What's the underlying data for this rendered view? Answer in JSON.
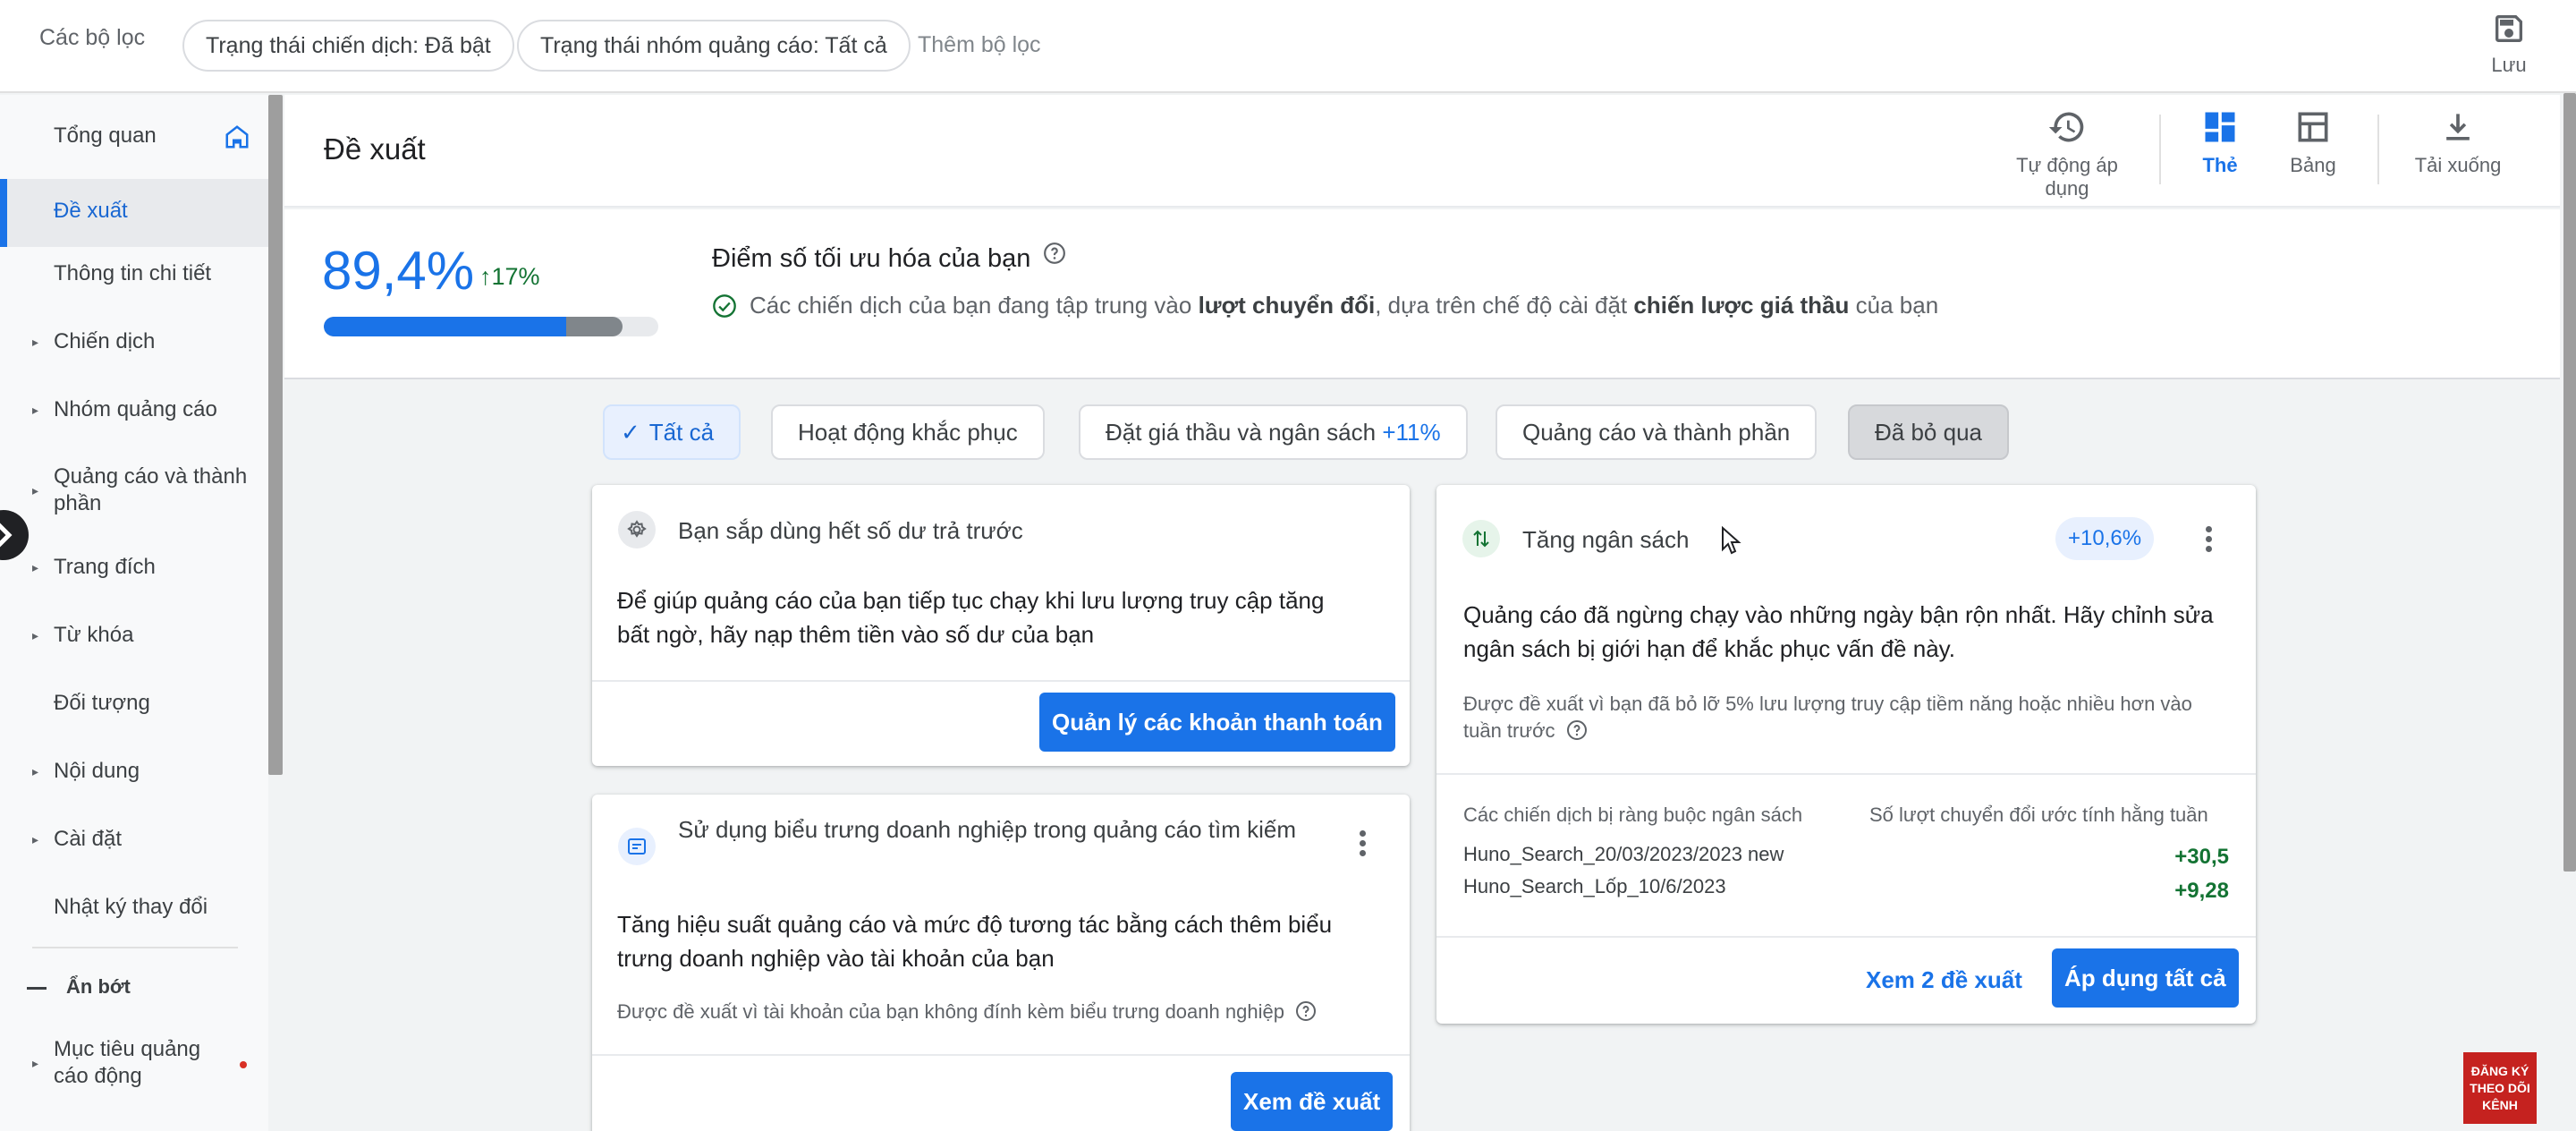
{
  "filters": {
    "label": "Các bộ lọc",
    "chips": [
      "Trạng thái chiến dịch: Đã bật",
      "Trạng thái nhóm quảng cáo: Tất cả"
    ],
    "add_filter": "Thêm bộ lọc",
    "save_label": "Lưu"
  },
  "sidebar": {
    "items": [
      {
        "label": "Tổng quan",
        "icon": "home-icon"
      },
      {
        "label": "Đề xuất",
        "active": true
      },
      {
        "label": "Thông tin chi tiết"
      },
      {
        "label": "Chiến dịch",
        "expandable": true
      },
      {
        "label": "Nhóm quảng cáo",
        "expandable": true
      },
      {
        "label": "Quảng cáo và thành phần",
        "expandable": true
      },
      {
        "label": "Trang đích",
        "expandable": true
      },
      {
        "label": "Từ khóa",
        "expandable": true
      },
      {
        "label": "Đối tượng"
      },
      {
        "label": "Nội dung",
        "expandable": true
      },
      {
        "label": "Cài đặt",
        "expandable": true
      },
      {
        "label": "Nhật ký thay đổi"
      },
      {
        "label": "Ẩn bớt"
      },
      {
        "label": "Mục tiêu quảng cáo động",
        "expandable": true
      }
    ]
  },
  "header": {
    "title": "Đề xuất",
    "auto_apply": "Tự động áp dụng",
    "cards_view": "Thẻ",
    "table_view": "Bảng",
    "download": "Tải xuống"
  },
  "score": {
    "value": "89,4%",
    "delta": "17%",
    "progress": 0.894,
    "uplift_progress": 0.17,
    "title": "Điểm số tối ưu hóa của bạn",
    "desc_1": "Các chiến dịch của bạn đang tập trung vào ",
    "desc_b1": "lượt chuyển đổi",
    "desc_2": ", dựa trên chế độ cài đặt ",
    "desc_b2": "chiến lược giá thầu",
    "desc_3": " của bạn"
  },
  "categories": {
    "all": "Tất cả",
    "fixes": "Hoạt động khắc phục",
    "bidding": "Đặt giá thầu và ngân sách",
    "bidding_uplift": "+11%",
    "ads": "Quảng cáo và thành phần",
    "dismissed": "Đã bỏ qua"
  },
  "card_balance": {
    "title": "Bạn sắp dùng hết số dư trả trước",
    "body": "Để giúp quảng cáo của bạn tiếp tục chạy khi lưu lượng truy cập tăng bất ngờ, hãy nạp thêm tiền vào số dư của bạn",
    "button": "Quản lý các khoản thanh toán"
  },
  "card_logo": {
    "title": "Sử dụng biểu trưng doanh nghiệp trong quảng cáo tìm kiếm",
    "body": "Tăng hiệu suất quảng cáo và mức độ tương tác bằng cách thêm biểu trưng doanh nghiệp vào tài khoản của bạn",
    "note": "Được đề xuất vì tài khoản của bạn không đính kèm biểu trưng doanh nghiệp",
    "button": "Xem đề xuất"
  },
  "card_budget": {
    "title": "Tăng ngân sách",
    "badge": "+10,6%",
    "body": "Quảng cáo đã ngừng chạy vào những ngày bận rộn nhất. Hãy chỉnh sửa ngân sách bị giới hạn để khắc phục vấn đề này.",
    "note": "Được đề xuất vì bạn đã bỏ lỡ 5% lưu lượng truy cập tiềm năng hoặc nhiều hơn vào tuần trước",
    "col_campaign": "Các chiến dịch bị ràng buộc ngân sách",
    "col_conversions": "Số lượt chuyển đổi ước tính hằng tuần",
    "rows": [
      {
        "name": "Huno_Search_20/03/2023/2023 new",
        "value": "+30,5"
      },
      {
        "name": "Huno_Search_Lốp_10/6/2023",
        "value": "+9,28"
      }
    ],
    "view_link": "Xem 2 đề xuất",
    "apply_all": "Áp dụng tất cả"
  },
  "subscribe_badge": {
    "line1": "ĐĂNG KÝ",
    "line2": "THEO DÕI",
    "line3": "KÊNH"
  },
  "colors": {
    "accent": "#1a73e8",
    "positive": "#137333",
    "background": "#f1f3f4",
    "subscribe": "#c5221f"
  }
}
